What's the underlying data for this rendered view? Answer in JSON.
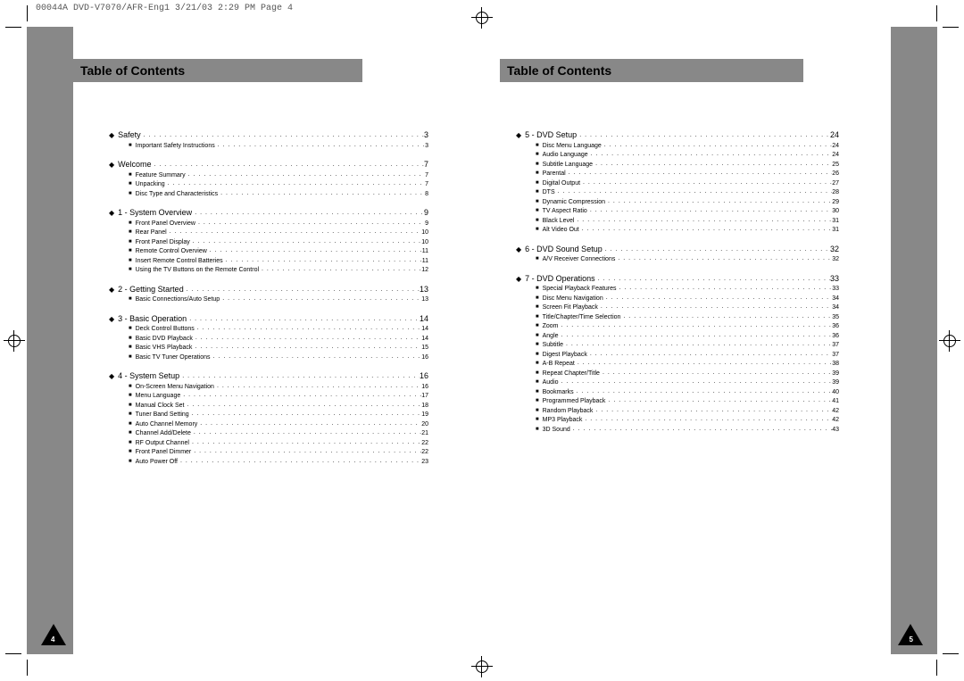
{
  "header": "00044A DVD-V7070/AFR-Eng1  3/21/03 2:29 PM  Page 4",
  "left": {
    "title": "Table of Contents",
    "page_num": "4",
    "sections": [
      {
        "title": "Safety",
        "page": "3",
        "subs": [
          {
            "title": "Important Safety Instructions",
            "page": "3"
          }
        ]
      },
      {
        "title": "Welcome",
        "page": "7",
        "subs": [
          {
            "title": "Feature Summary",
            "page": "7"
          },
          {
            "title": "Unpacking",
            "page": "7"
          },
          {
            "title": "Disc Type and Characteristics",
            "page": "8"
          }
        ]
      },
      {
        "title": "1 - System Overview",
        "page": "9",
        "subs": [
          {
            "title": "Front Panel Overview",
            "page": "9"
          },
          {
            "title": "Rear Panel",
            "page": "10"
          },
          {
            "title": "Front Panel Display",
            "page": "10"
          },
          {
            "title": "Remote Control Overview",
            "page": "11"
          },
          {
            "title": "Insert Remote Control Batteries",
            "page": "11"
          },
          {
            "title": "Using the TV Buttons on the Remote Control",
            "page": "12"
          }
        ]
      },
      {
        "title": "2 - Getting Started",
        "page": "13",
        "subs": [
          {
            "title": "Basic Connections/Auto Setup",
            "page": "13"
          }
        ]
      },
      {
        "title": "3 - Basic Operation",
        "page": "14",
        "subs": [
          {
            "title": "Deck Control Buttons",
            "page": "14"
          },
          {
            "title": "Basic DVD Playback",
            "page": "14"
          },
          {
            "title": "Basic VHS Playback",
            "page": "15"
          },
          {
            "title": "Basic TV Tuner Operations",
            "page": "16"
          }
        ]
      },
      {
        "title": "4 - System Setup",
        "page": "16",
        "subs": [
          {
            "title": "On-Screen Menu Navigation",
            "page": "16"
          },
          {
            "title": "Menu Language",
            "page": "17"
          },
          {
            "title": "Manual Clock Set",
            "page": "18"
          },
          {
            "title": "Tuner Band Setting",
            "page": "19"
          },
          {
            "title": "Auto Channel Memory",
            "page": "20"
          },
          {
            "title": "Channel Add/Delete",
            "page": "21"
          },
          {
            "title": "RF Output Channel",
            "page": "22"
          },
          {
            "title": "Front Panel Dimmer",
            "page": "22"
          },
          {
            "title": "Auto Power Off",
            "page": "23"
          }
        ]
      }
    ]
  },
  "right": {
    "title": "Table of Contents",
    "page_num": "5",
    "sections": [
      {
        "title": "5 - DVD Setup",
        "page": "24",
        "subs": [
          {
            "title": "Disc Menu Language",
            "page": "24"
          },
          {
            "title": "Audio Language",
            "page": "24"
          },
          {
            "title": "Subtitle Language",
            "page": "25"
          },
          {
            "title": "Parental",
            "page": "26"
          },
          {
            "title": "Digital Output",
            "page": "27"
          },
          {
            "title": "DTS",
            "page": "28"
          },
          {
            "title": "Dynamic Compression",
            "page": "29"
          },
          {
            "title": "TV Aspect Ratio",
            "page": "30"
          },
          {
            "title": "Black Level",
            "page": "31"
          },
          {
            "title": "Alt Video Out",
            "page": "31"
          }
        ]
      },
      {
        "title": "6 - DVD Sound Setup",
        "page": "32",
        "subs": [
          {
            "title": "A/V Receiver Connections",
            "page": "32"
          }
        ]
      },
      {
        "title": "7 - DVD Operations",
        "page": "33",
        "subs": [
          {
            "title": "Special Playback Features",
            "page": "33"
          },
          {
            "title": "Disc Menu Navigation",
            "page": "34"
          },
          {
            "title": "Screen Fit Playback",
            "page": "34"
          },
          {
            "title": "Title/Chapter/Time Selection",
            "page": "35"
          },
          {
            "title": "Zoom",
            "page": "36"
          },
          {
            "title": "Angle",
            "page": "36"
          },
          {
            "title": "Subtitle",
            "page": "37"
          },
          {
            "title": "Digest Playback",
            "page": "37"
          },
          {
            "title": "A-B Repeat",
            "page": "38"
          },
          {
            "title": "Repeat Chapter/Title",
            "page": "39"
          },
          {
            "title": "Audio",
            "page": "39"
          },
          {
            "title": "Bookmarks",
            "page": "40"
          },
          {
            "title": "Programmed Playback",
            "page": "41"
          },
          {
            "title": "Random Playback",
            "page": "42"
          },
          {
            "title": "MP3 Playback",
            "page": "42"
          },
          {
            "title": "3D Sound",
            "page": "43"
          }
        ]
      }
    ]
  }
}
